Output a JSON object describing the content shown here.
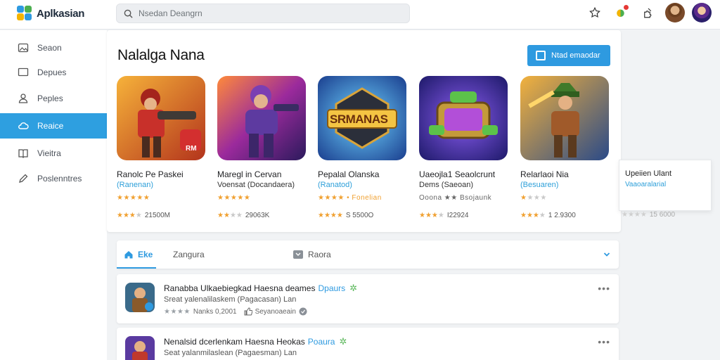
{
  "app": {
    "name": "Aplkasian"
  },
  "search": {
    "placeholder": "Nsedan Deangrn"
  },
  "colors": {
    "accent": "#2e9ae0",
    "star": "#f0a030",
    "badge": "#e53935"
  },
  "sidebar": {
    "items": [
      {
        "label": "Seaon",
        "icon": "image-icon"
      },
      {
        "label": "Depues",
        "icon": "monitor-icon"
      },
      {
        "label": "Peples",
        "icon": "person-icon"
      },
      {
        "label": "Reaice",
        "icon": "cloud-icon",
        "active": true
      },
      {
        "label": "Vieitra",
        "icon": "book-icon"
      },
      {
        "label": "Poslenntres",
        "icon": "pencil-icon"
      }
    ]
  },
  "featured": {
    "title": "Nalalga Nana",
    "cta_label": "Ntad emaodar",
    "games": [
      {
        "title": "Ranolc Pe Paskei",
        "subtitle": "(Ranenan)",
        "stars": "★★★★★",
        "badge": "RM",
        "rating_count": "21500M"
      },
      {
        "title": "Maregl in Cervan",
        "subtitle": "Voensat (Docandaera)",
        "stars": "★★★★★",
        "rating_count": "29063K"
      },
      {
        "title": "Pepalal Olanska",
        "subtitle": "(Ranatod)",
        "stars": "★★★★ • Fonelian",
        "art_text": "SRMANAS",
        "rating_count": "S 5500O"
      },
      {
        "title": "Uaeojla1 Seaolcrunt",
        "subtitle": "Dems (Saeoan)",
        "stars": "Ooona ★★ Bsojaunk",
        "rating_count": "I22924"
      },
      {
        "title": "Relarlaoi Nia",
        "subtitle": "(Besuaren)",
        "stars": "★",
        "rating_count": "1 2.9300"
      }
    ],
    "peek": {
      "title": "Upeiien Ulant",
      "subtitle": "Vaaoaralarial",
      "rating_count": "15 6000"
    }
  },
  "tabs": [
    {
      "label": "Eke",
      "icon": "home-icon",
      "active": true
    },
    {
      "label": "Zangura"
    },
    {
      "label": "Raora",
      "icon": "chat-icon"
    }
  ],
  "list": [
    {
      "title": "Ranabba Ulkaebiegkad Haesna deames",
      "tag": "Dpaurs",
      "subtitle": "Sreat yalenalilaskem (Pagacasan) Lan",
      "meta_stars": "★★★★",
      "meta_text": "Nanks 0,2001",
      "meta_extra": "Seyanoaeain"
    },
    {
      "title": "Nenalsid dcerlenkam Haesna Heokas",
      "tag": "Poaura",
      "subtitle": "Seat yalanmilaslean (Pagaesman) Lan",
      "meta_stars": "",
      "meta_text": "",
      "meta_extra": ""
    }
  ]
}
